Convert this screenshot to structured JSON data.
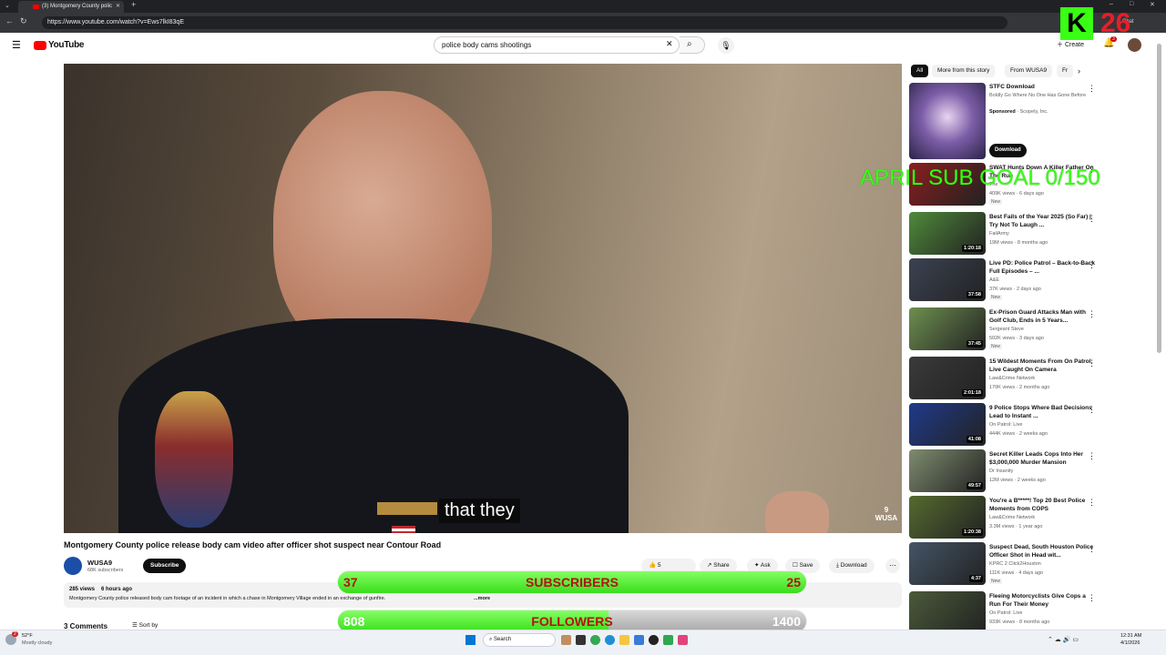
{
  "browser": {
    "tab_title": "(3) Montgomery County polic",
    "url": "https://www.youtube.com/watch?v=Ews7lkI83qE",
    "chat_label": "Chat"
  },
  "youtube": {
    "logo_text": "YouTube",
    "search_value": "police body cams shootings",
    "create_label": "Create",
    "notification_count": "3"
  },
  "video": {
    "caption": "that they",
    "watermark": "9 WUSA",
    "title": "Montgomery County police release body cam video after officer shot suspect near Contour Road",
    "channel": "WUSA9",
    "subscribers": "68K subscribers",
    "subscribe_label": "Subscribe",
    "likes": "5",
    "share_label": "Share",
    "ask_label": "Ask",
    "save_label": "Save",
    "download_label": "Download",
    "views": "285 views",
    "age": "6 hours ago",
    "description": "Montgomery County police released body cam footage of an incident in which a chase in Montgomery Village ended in an exchange of gunfire.",
    "more_label": "...more",
    "comments": "3 Comments",
    "sort_label": "Sort by"
  },
  "chips": [
    "All",
    "More from this story",
    "From WUSA9",
    "Fr"
  ],
  "ad": {
    "title": "STFC Download",
    "subtitle": "Boldly Go Where No One Has Gone Before",
    "sponsored": "Sponsored",
    "advertiser": "Scopely, Inc.",
    "button": "Download"
  },
  "recommendations": [
    {
      "title": "SWAT Hunts Down A Killer Father On The Run",
      "channel": "The",
      "meta": "409K views · 6 days ago",
      "badge": "New",
      "duration": ""
    },
    {
      "title": "Best Fails of the Year 2025 (So Far) | Try Not To Laugh ...",
      "channel": "FailArmy",
      "meta": "19M views · 8 months ago",
      "badge": "",
      "duration": "1:20:18"
    },
    {
      "title": "Live PD: Police Patrol – Back-to-Back Full Episodes – ...",
      "channel": "A&E",
      "meta": "37K views · 2 days ago",
      "badge": "New",
      "duration": "37:58"
    },
    {
      "title": "Ex-Prison Guard Attacks Man with Golf Club, Ends in 5 Years...",
      "channel": "Sergeant Steve",
      "meta": "502K views · 3 days ago",
      "badge": "New",
      "duration": "37:45"
    },
    {
      "title": "15  Wildest Moments From On Patrol: Live Caught On Camera",
      "channel": "Law&Crime Network",
      "meta": "170K views · 2 months ago",
      "badge": "",
      "duration": "2:01:18"
    },
    {
      "title": "9 Police Stops Where Bad Decisions Lead to Instant ...",
      "channel": "On Patrol: Live",
      "meta": "444K views · 2 weeks ago",
      "badge": "",
      "duration": "41:08"
    },
    {
      "title": "Secret Killer Leads Cops Into Her $3,000,000 Murder Mansion",
      "channel": "Dr Insanity",
      "meta": "12M views · 2 weeks ago",
      "badge": "",
      "duration": "49:57"
    },
    {
      "title": "You're a B*****! Top 20 Best Police Moments from COPS",
      "channel": "Law&Crime Network",
      "meta": "3.3M views · 1 year ago",
      "badge": "",
      "duration": "1:20:38"
    },
    {
      "title": "Suspect Dead, South Houston Police Officer Shot in Head wit...",
      "channel": "KPRC 2 Click2Houston",
      "meta": "111K views · 4 days ago",
      "badge": "New",
      "duration": "4:37"
    },
    {
      "title": "Fleeing Motorcyclists Give Cops a Run For Their Money",
      "channel": "On Patrol: Live",
      "meta": "933K views · 8 months ago",
      "badge": "",
      "duration": ""
    }
  ],
  "overlay": {
    "sub_goal": "APRIL SUB GOAL 0/150",
    "subscribers_label": "SUBSCRIBERS",
    "subscribers_current": "37",
    "subscribers_goal": "25",
    "subscribers_progress": 1.0,
    "followers_label": "FOLLOWERS",
    "followers_current": "808",
    "followers_goal": "1400",
    "followers_progress": 0.577,
    "stream_logo": "K",
    "stream_number": "26"
  },
  "taskbar": {
    "weather_temp": "52°F",
    "weather_desc": "Mostly cloudy",
    "weather_badge": "2",
    "search_label": "Search",
    "time": "12:31 AM",
    "date": "4/1/2026"
  },
  "colors": {
    "yt_red": "#ff0000",
    "progress_green": "#3add1c",
    "overlay_text": "#b31212",
    "goal_green": "#39ff14"
  }
}
